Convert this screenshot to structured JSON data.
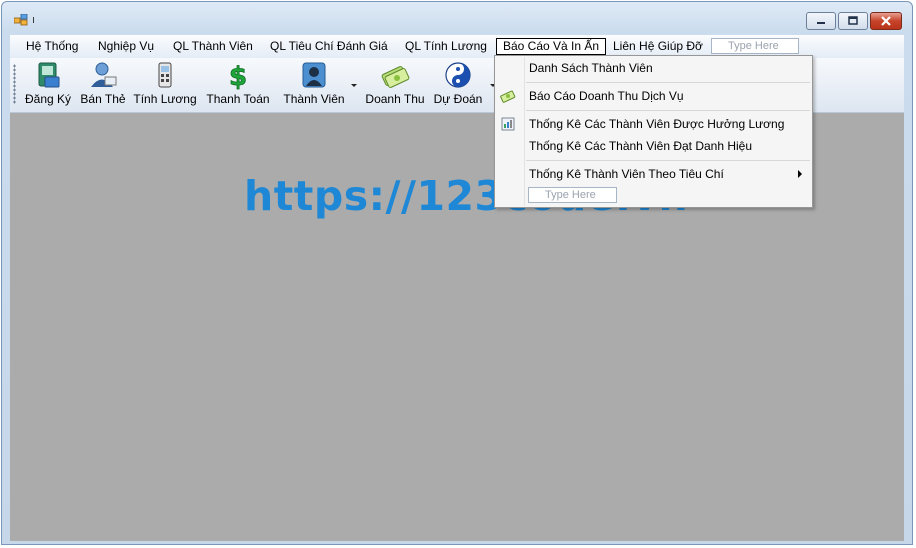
{
  "window": {
    "title": "ı"
  },
  "menubar": {
    "items": [
      {
        "label": "Hệ Thống"
      },
      {
        "label": "Nghiệp Vụ"
      },
      {
        "label": "QL Thành Viên"
      },
      {
        "label": "QL Tiêu Chí Đánh Giá"
      },
      {
        "label": "QL Tính Lương"
      },
      {
        "label": "Báo Cáo Và In Ấn"
      },
      {
        "label": "Liên Hệ Giúp Đỡ"
      }
    ],
    "type_here": "Type Here"
  },
  "toolbar": {
    "buttons": [
      {
        "label": "Đăng Ký",
        "icon": "register-icon"
      },
      {
        "label": "Bán Thẻ",
        "icon": "card-sell-icon"
      },
      {
        "label": "Tính Lương",
        "icon": "calculator-icon"
      },
      {
        "label": "Thanh Toán",
        "icon": "dollar-icon"
      },
      {
        "label": "Thành Viên",
        "icon": "member-icon"
      },
      {
        "label": "Doanh Thu",
        "icon": "money-icon"
      },
      {
        "label": "Dự Đoán",
        "icon": "yin-yang-icon"
      }
    ]
  },
  "dropdown": {
    "items": [
      {
        "label": "Danh Sách Thành Viên"
      },
      {
        "label": "Báo Cáo Doanh Thu Dịch Vụ"
      },
      {
        "label": "Thống Kê Các Thành Viên Được Hưởng Lương"
      },
      {
        "label": "Thống Kê Các Thành Viên Đạt Danh Hiệu"
      },
      {
        "label": "Thống Kê Thành Viên Theo Tiêu Chí"
      }
    ],
    "type_here": "Type Here"
  },
  "watermark": "https://123code.vn",
  "colors": {
    "client_bg": "#ababab",
    "watermark": "#1e88d6",
    "close_button": "#c7432a"
  }
}
